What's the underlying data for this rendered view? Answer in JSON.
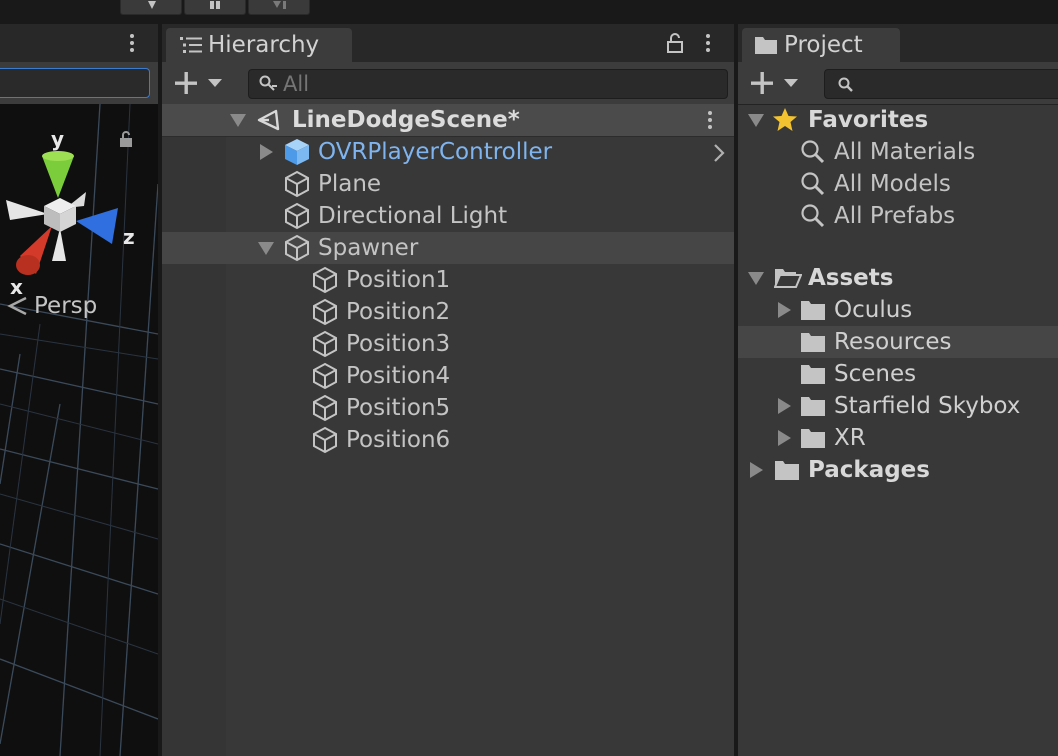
{
  "scene": {
    "gizmo": {
      "y": "y",
      "z": "z",
      "x": "x"
    },
    "projection_label": "Persp"
  },
  "hierarchy": {
    "tab_label": "Hierarchy",
    "search_placeholder": "All",
    "scene_name": "LineDodgeScene*",
    "items": [
      {
        "label": "OVRPlayerController"
      },
      {
        "label": "Plane"
      },
      {
        "label": "Directional Light"
      },
      {
        "label": "Spawner"
      },
      {
        "label": "Position1"
      },
      {
        "label": "Position2"
      },
      {
        "label": "Position3"
      },
      {
        "label": "Position4"
      },
      {
        "label": "Position5"
      },
      {
        "label": "Position6"
      }
    ]
  },
  "project": {
    "tab_label": "Project",
    "favorites": {
      "label": "Favorites",
      "items": [
        {
          "label": "All Materials"
        },
        {
          "label": "All Models"
        },
        {
          "label": "All Prefabs"
        }
      ]
    },
    "assets": {
      "label": "Assets",
      "items": [
        {
          "label": "Oculus"
        },
        {
          "label": "Resources"
        },
        {
          "label": "Scenes"
        },
        {
          "label": "Starfield Skybox"
        },
        {
          "label": "XR"
        }
      ]
    },
    "packages": {
      "label": "Packages"
    }
  },
  "colors": {
    "prefab_blue": "#7fb4ee",
    "favorites_star": "#f2c230",
    "panel_bg": "#383838",
    "selected_row": "#464646"
  }
}
